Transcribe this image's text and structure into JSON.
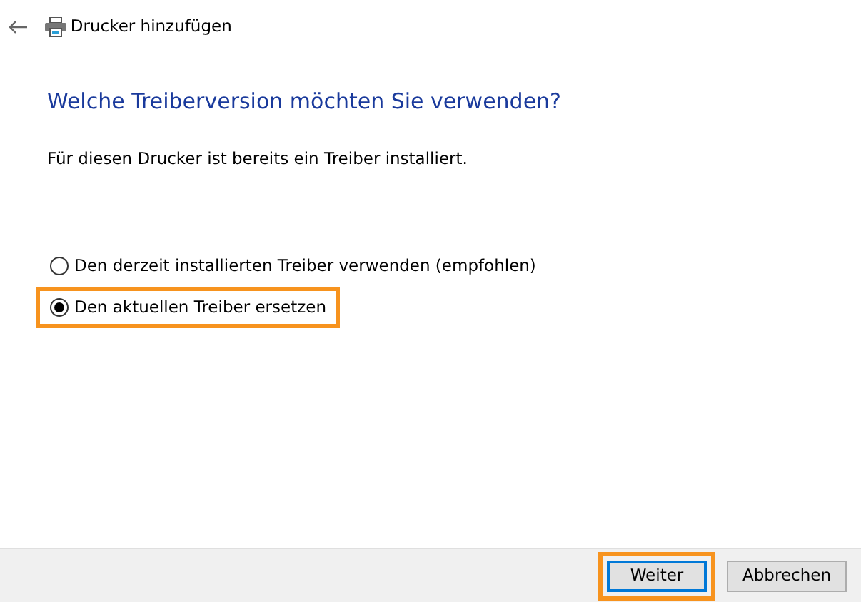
{
  "window": {
    "title": "Drucker hinzufügen"
  },
  "heading": "Welche Treiberversion möchten Sie verwenden?",
  "description": "Für diesen Drucker ist bereits ein Treiber installiert.",
  "options": [
    {
      "label": "Den derzeit installierten Treiber verwenden (empfohlen)",
      "selected": false,
      "highlighted": false
    },
    {
      "label": "Den aktuellen Treiber ersetzen",
      "selected": true,
      "highlighted": true
    }
  ],
  "buttons": [
    {
      "label": "Weiter",
      "default": true,
      "highlighted": true
    },
    {
      "label": "Abbrechen",
      "default": false,
      "highlighted": false
    }
  ]
}
